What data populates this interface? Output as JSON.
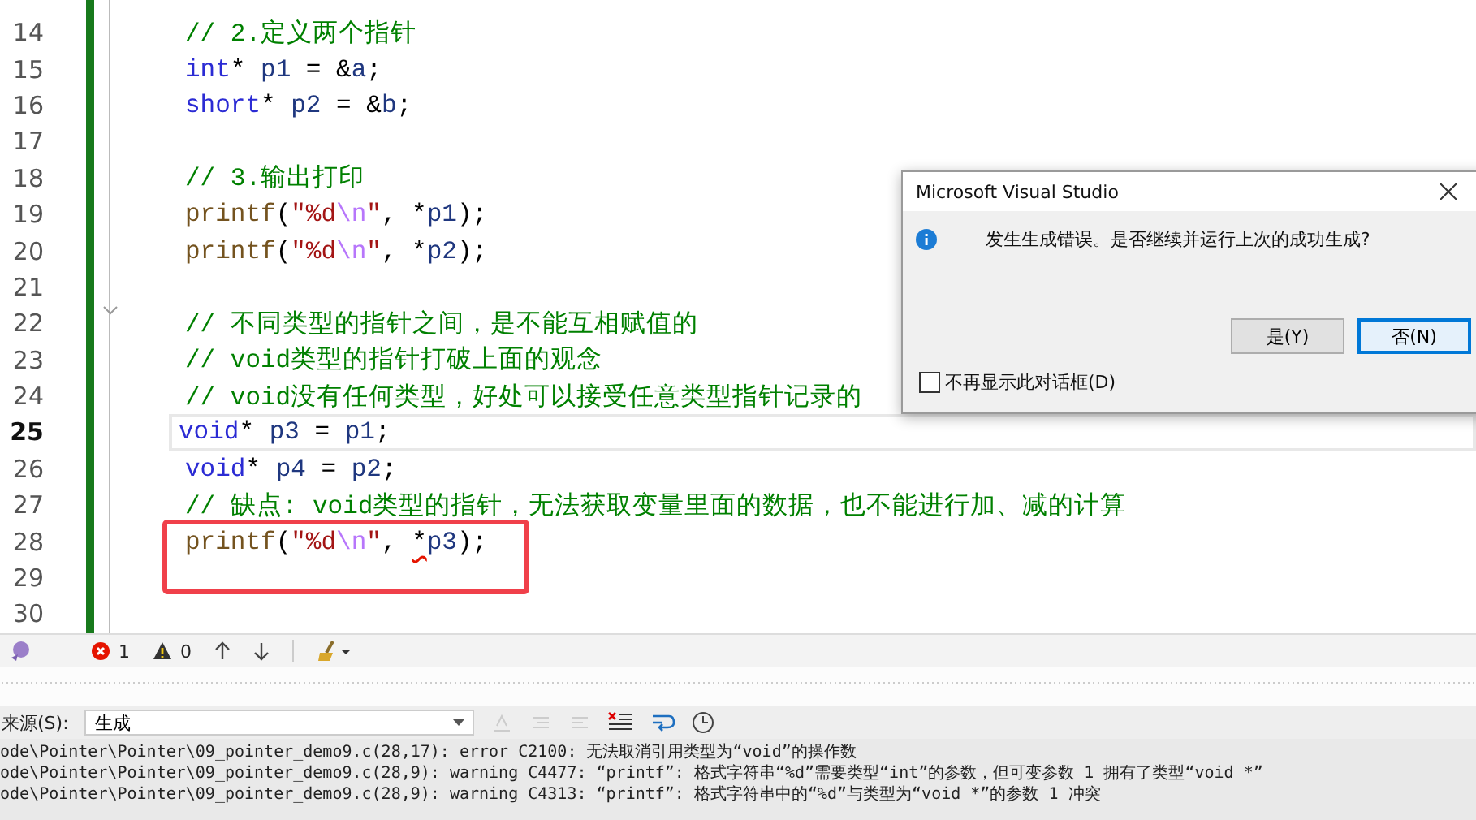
{
  "editor": {
    "lines": [
      {
        "number": "14",
        "current": false,
        "boxed": false,
        "tokens": [
          {
            "kind": "comment",
            "text": "// 2.定义两个指针"
          }
        ]
      },
      {
        "number": "15",
        "current": false,
        "boxed": false,
        "tokens": [
          {
            "kind": "keyword",
            "text": "int"
          },
          {
            "kind": "plain",
            "text": "* "
          },
          {
            "kind": "ident",
            "text": "p1"
          },
          {
            "kind": "plain",
            "text": " = &"
          },
          {
            "kind": "ident",
            "text": "a"
          },
          {
            "kind": "plain",
            "text": ";"
          }
        ]
      },
      {
        "number": "16",
        "current": false,
        "boxed": false,
        "tokens": [
          {
            "kind": "keyword",
            "text": "short"
          },
          {
            "kind": "plain",
            "text": "* "
          },
          {
            "kind": "ident",
            "text": "p2"
          },
          {
            "kind": "plain",
            "text": " = &"
          },
          {
            "kind": "ident",
            "text": "b"
          },
          {
            "kind": "plain",
            "text": ";"
          }
        ]
      },
      {
        "number": "17",
        "current": false,
        "boxed": false
      },
      {
        "number": "18",
        "current": false,
        "boxed": false,
        "tokens": [
          {
            "kind": "comment",
            "text": "// 3.输出打印"
          }
        ]
      },
      {
        "number": "19",
        "current": false,
        "boxed": false,
        "tokens": [
          {
            "kind": "function",
            "text": "printf"
          },
          {
            "kind": "plain",
            "text": "("
          },
          {
            "kind": "string",
            "text": "\"%d"
          },
          {
            "kind": "escape",
            "text": "\\n"
          },
          {
            "kind": "string",
            "text": "\""
          },
          {
            "kind": "plain",
            "text": ", *"
          },
          {
            "kind": "ident",
            "text": "p1"
          },
          {
            "kind": "plain",
            "text": ");"
          }
        ]
      },
      {
        "number": "20",
        "current": false,
        "boxed": false,
        "tokens": [
          {
            "kind": "function",
            "text": "printf"
          },
          {
            "kind": "plain",
            "text": "("
          },
          {
            "kind": "string",
            "text": "\"%d"
          },
          {
            "kind": "escape",
            "text": "\\n"
          },
          {
            "kind": "string",
            "text": "\""
          },
          {
            "kind": "plain",
            "text": ", *"
          },
          {
            "kind": "ident",
            "text": "p2"
          },
          {
            "kind": "plain",
            "text": ");"
          }
        ]
      },
      {
        "number": "21",
        "current": false,
        "boxed": false
      },
      {
        "number": "22",
        "current": false,
        "boxed": false,
        "fold": true,
        "tokens": [
          {
            "kind": "comment",
            "text": "// 不同类型的指针之间，是不能互相赋值的"
          }
        ]
      },
      {
        "number": "23",
        "current": false,
        "boxed": false,
        "tokens": [
          {
            "kind": "comment",
            "text": "// void类型的指针打破上面的观念"
          }
        ]
      },
      {
        "number": "24",
        "current": false,
        "boxed": false,
        "tokens": [
          {
            "kind": "comment",
            "text": "// void没有任何类型，好处可以接受任意类型指针记录的"
          }
        ]
      },
      {
        "number": "25",
        "current": true,
        "boxed": false,
        "tokens": [
          {
            "kind": "keyword",
            "text": "void"
          },
          {
            "kind": "plain",
            "text": "* "
          },
          {
            "kind": "ident",
            "text": "p3"
          },
          {
            "kind": "plain",
            "text": " = "
          },
          {
            "kind": "ident",
            "text": "p1"
          },
          {
            "kind": "plain",
            "text": ";"
          }
        ]
      },
      {
        "number": "26",
        "current": false,
        "boxed": false,
        "tokens": [
          {
            "kind": "keyword",
            "text": "void"
          },
          {
            "kind": "plain",
            "text": "* "
          },
          {
            "kind": "ident",
            "text": "p4"
          },
          {
            "kind": "plain",
            "text": " = "
          },
          {
            "kind": "ident",
            "text": "p2"
          },
          {
            "kind": "plain",
            "text": ";"
          }
        ]
      },
      {
        "number": "27",
        "current": false,
        "boxed": false,
        "tokens": [
          {
            "kind": "comment",
            "text": "// 缺点: void类型的指针，无法获取变量里面的数据，也不能进行加、减的计算"
          }
        ]
      },
      {
        "number": "28",
        "current": false,
        "boxed": true,
        "tokens": [
          {
            "kind": "function",
            "text": "printf"
          },
          {
            "kind": "plain",
            "text": "("
          },
          {
            "kind": "string",
            "text": "\"%d"
          },
          {
            "kind": "escape",
            "text": "\\n"
          },
          {
            "kind": "string",
            "text": "\""
          },
          {
            "kind": "plain",
            "text": ", "
          },
          {
            "kind": "error",
            "text": "*"
          },
          {
            "kind": "ident",
            "text": "p3"
          },
          {
            "kind": "plain",
            "text": ");"
          }
        ]
      },
      {
        "number": "29",
        "current": false,
        "boxed": true
      },
      {
        "number": "30",
        "current": false,
        "boxed": false
      }
    ]
  },
  "dialog": {
    "title": "Microsoft Visual Studio",
    "message": "发生生成错误。是否继续并运行上次的成功生成?",
    "buttons": [
      {
        "label": "是(Y)",
        "selected": false
      },
      {
        "label": "否(N)",
        "selected": true
      }
    ],
    "checkbox": {
      "label": "不再显示此对话框(D)",
      "checked": false
    }
  },
  "toolbar": {
    "errors": "1",
    "warnings": "0"
  },
  "output": {
    "source_label": "来源(S):",
    "source_value": "生成",
    "lines": [
      "ode\\Pointer\\Pointer\\09_pointer_demo9.c(28,17): error C2100: 无法取消引用类型为“void”的操作数",
      "ode\\Pointer\\Pointer\\09_pointer_demo9.c(28,9): warning C4477: “printf”: 格式字符串“%d”需要类型“int”的参数，但可变参数 1 拥有了类型“void *”",
      "ode\\Pointer\\Pointer\\09_pointer_demo9.c(28,9): warning C4313: “printf”: 格式字符串中的“%d”与类型为“void *”的参数 1 冲突"
    ]
  }
}
